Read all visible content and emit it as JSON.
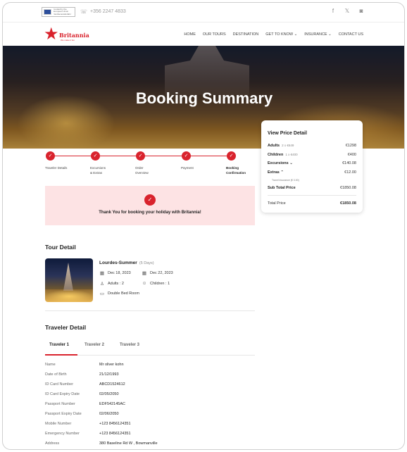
{
  "topbar": {
    "eu_logo_text": "Funded by the European Union NextGenerationEU",
    "phone": "+356 2247 4833",
    "socials": [
      "facebook-icon",
      "x-icon",
      "tripadvisor-icon"
    ]
  },
  "brand": {
    "name": "Britannia",
    "tagline": "We make it fun"
  },
  "nav": [
    {
      "label": "HOME"
    },
    {
      "label": "OUR TOURS"
    },
    {
      "label": "DESTINATION"
    },
    {
      "label": "GET TO KNOW"
    },
    {
      "label": "INSURANCE"
    },
    {
      "label": "CONTACT US"
    }
  ],
  "nav_dropdown_glyph": "⌄",
  "hero": {
    "title": "Booking Summary"
  },
  "steps": [
    {
      "label": "Traveler Details"
    },
    {
      "label": "Excursions\n& Extras"
    },
    {
      "label": "Order\nOverview"
    },
    {
      "label": "Payment"
    },
    {
      "label": "Booking\nConfirmation"
    }
  ],
  "check_glyph": "✓",
  "thanks": {
    "text": "Thank You for booking your holiday with Britannia!"
  },
  "price": {
    "title": "View Price Detail",
    "adults_label": "Adults",
    "adults_detail": "2 x €649",
    "adults_value": "€1298",
    "children_label": "Children",
    "children_detail": "1 x €400",
    "children_value": "€400",
    "excursions_label": "Excursions",
    "excursions_value": "€140.08",
    "extras_label": "Extras",
    "extras_value": "€12.00",
    "extras_sub": "Travel insurance (€ 3.00)",
    "subtotal_label": "Sub Total Price",
    "subtotal_value": "€1850.08",
    "total_label": "Total Price",
    "total_value": "€1850.08"
  },
  "tour": {
    "section_title": "Tour Detail",
    "name": "Lourdes-Summer",
    "days": "(5 Days)",
    "start_date": "Dec 18, 2023",
    "end_date": "Dec 22, 2023",
    "adults": "Adults : 2",
    "children": "Children : 1",
    "room": "Double Bed Room"
  },
  "traveler": {
    "section_title": "Traveler Detail",
    "tabs": [
      {
        "label": "Traveler 1"
      },
      {
        "label": "Traveler 2"
      },
      {
        "label": "Traveler 3"
      }
    ],
    "fields": [
      {
        "key": "Name",
        "value": "Mr oliver kohn"
      },
      {
        "key": "Date of Birth",
        "value": "21/12/1993"
      },
      {
        "key": "ID Card Number",
        "value": "ABCD1524612"
      },
      {
        "key": "ID Card Expiry Date",
        "value": "02/05/2050"
      },
      {
        "key": "Passport Number",
        "value": "EDF542145AC"
      },
      {
        "key": "Passport Expiry Date",
        "value": "02/06/2050"
      },
      {
        "key": "Mobile Number",
        "value": "+123 8456124351"
      },
      {
        "key": "Emergency Number",
        "value": "+123 8456124351"
      },
      {
        "key": "Address",
        "value": "380 Baseline Rd W , Bowmanville"
      }
    ]
  },
  "colors": {
    "accent": "#d9232d",
    "thanks_bg": "#fde3e4"
  }
}
